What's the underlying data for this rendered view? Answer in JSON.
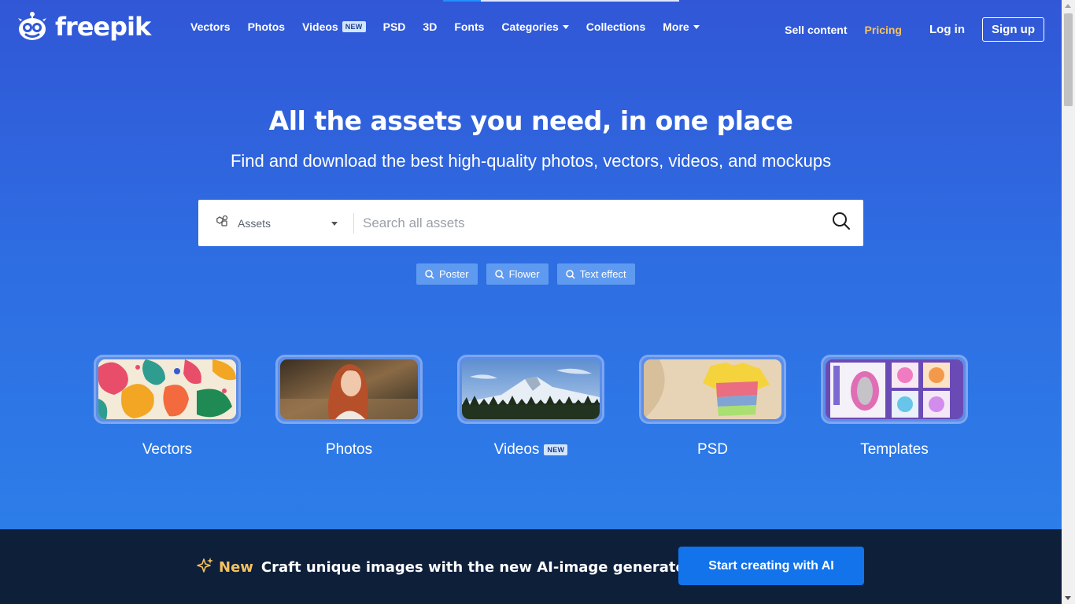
{
  "brand": {
    "name": "freepik"
  },
  "nav": {
    "items": [
      {
        "label": "Vectors"
      },
      {
        "label": "Photos"
      },
      {
        "label": "Videos",
        "badge": "NEW"
      },
      {
        "label": "PSD"
      },
      {
        "label": "3D"
      },
      {
        "label": "Fonts"
      },
      {
        "label": "Categories",
        "dropdown": true
      },
      {
        "label": "Collections"
      },
      {
        "label": "More",
        "dropdown": true
      }
    ],
    "sell_content": "Sell content",
    "pricing": "Pricing",
    "login": "Log in",
    "signup": "Sign up"
  },
  "hero": {
    "title": "All the assets you need, in one place",
    "subtitle": "Find and download the best high-quality photos, vectors, videos, and mockups"
  },
  "search": {
    "asset_type": "Assets",
    "placeholder": "Search all assets",
    "value": ""
  },
  "tags": [
    {
      "label": "Poster"
    },
    {
      "label": "Flower"
    },
    {
      "label": "Text effect"
    }
  ],
  "categories": [
    {
      "label": "Vectors"
    },
    {
      "label": "Photos"
    },
    {
      "label": "Videos",
      "badge": "NEW"
    },
    {
      "label": "PSD"
    },
    {
      "label": "Templates"
    }
  ],
  "banner": {
    "new_label": "New",
    "text": "Craft unique images with the new AI-image generator",
    "cta": "Start creating with AI"
  },
  "colors": {
    "accent": "#1273eb",
    "pricing": "#f5c260",
    "banner_bg": "#0e1f3a"
  }
}
